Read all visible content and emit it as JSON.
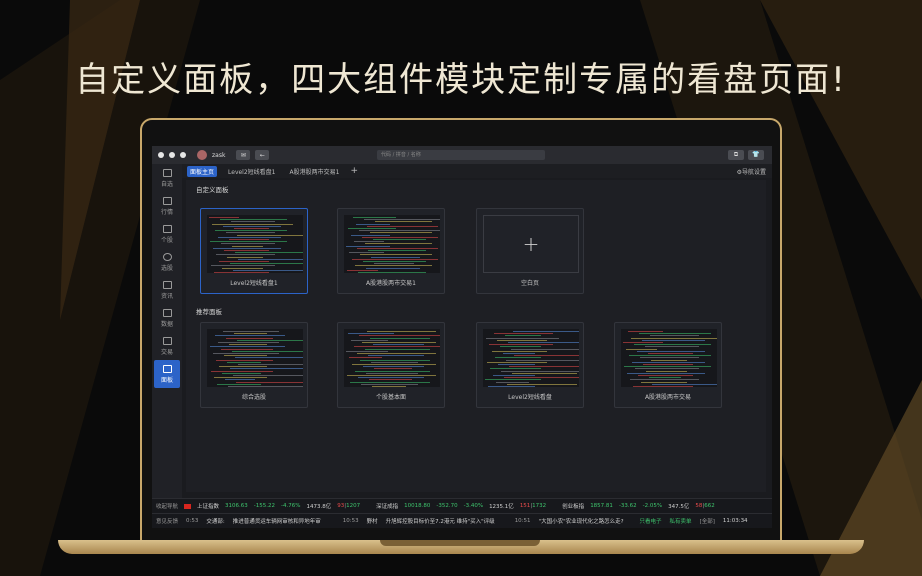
{
  "headline": "自定义面板，四大组件模块定制专属的看盘页面!",
  "colors": {
    "accent": "#2c63c8",
    "gold": "#c8a86b",
    "up": "#e84b4b",
    "down": "#3ec46d"
  },
  "titlebar": {
    "username": "zask",
    "search_placeholder": "代码 / 拼音 / 名称"
  },
  "sidebar": {
    "items": [
      {
        "label": "自选",
        "icon": "watchlist-icon"
      },
      {
        "label": "行情",
        "icon": "market-icon"
      },
      {
        "label": "个股",
        "icon": "stock-icon"
      },
      {
        "label": "选股",
        "icon": "screener-icon"
      },
      {
        "label": "资讯",
        "icon": "news-icon"
      },
      {
        "label": "数据",
        "icon": "data-icon"
      },
      {
        "label": "交易",
        "icon": "trade-icon"
      },
      {
        "label": "面板",
        "icon": "panel-icon"
      }
    ]
  },
  "tabs": {
    "items": [
      "面板主页",
      "Level2短线看盘1",
      "A股港股两市交易1"
    ],
    "add": "+",
    "nav_settings": "⚙导航设置"
  },
  "custom_section": {
    "title": "自定义面板",
    "cards": [
      "Level2短线看盘1",
      "A股港股两市交易1",
      "空白页"
    ]
  },
  "recommended_section": {
    "title": "推荐面板",
    "cards": [
      "综合选股",
      "个股基本面",
      "Level2短线看盘",
      "A股港股两市交易"
    ]
  },
  "ticker": {
    "left": "收起导航",
    "sh_name": "上证指数",
    "sh_price": "3106.63",
    "sh_change": "-155.22",
    "sh_pct": "-4.76%",
    "sh_vol": "1473.8亿",
    "sh_adv": "93",
    "sh_dec": "1207",
    "sz_name": "深证成指",
    "sz_price": "10018.80",
    "sz_change": "-352.70",
    "sz_pct": "-3.40%",
    "sz_vol": "1235.1亿",
    "sz_adv": "151",
    "sz_dec": "1732",
    "cy_name": "创业板指",
    "cy_price": "1857.81",
    "cy_change": "-33.62",
    "cy_pct": "-2.05%",
    "cy_vol": "347.5亿",
    "cy_adv": "58",
    "cy_dec": "662"
  },
  "news": {
    "label": "意见反馈",
    "t1": "0:53",
    "src1": "交通部:",
    "h1": "推进普通货运车辆网审核和异地年审",
    "t2": "10:53",
    "src2": "野村",
    "h2": "升旭辉控股目标价至7.2港元 维持\"买入\"评级",
    "t3": "10:51",
    "h3": "\"大国小农\"农业现代化之路怎么走?",
    "badge1": "只看电子",
    "badge2": "私有卖单",
    "badge3": "[全部]",
    "clock": "11:03:34"
  }
}
